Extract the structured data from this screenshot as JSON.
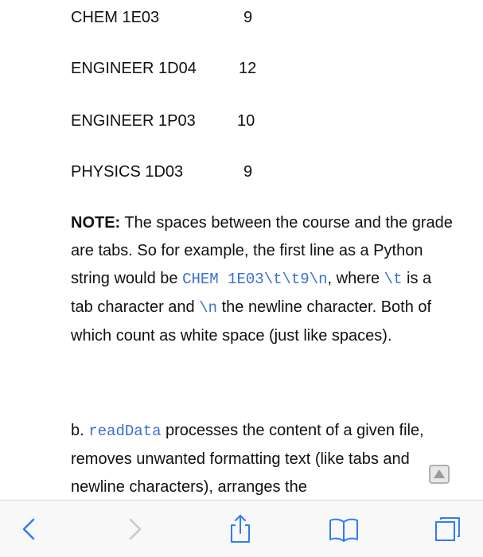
{
  "grades": [
    {
      "course": "CHEM 1E03",
      "grade": "9"
    },
    {
      "course": "ENGINEER 1D04",
      "grade": "12"
    },
    {
      "course": "ENGINEER 1P03",
      "grade": "10"
    },
    {
      "course": "PHYSICS 1D03",
      "grade": "9"
    }
  ],
  "note": {
    "label": "NOTE:",
    "text1": " The spaces between the course and the grade are tabs. So for example, the first line as a Python string would be ",
    "code1": "CHEM 1E03\\t\\t9\\n",
    "text2": ", where ",
    "code2": "\\t",
    "text3": " is a tab character and ",
    "code3": "\\n",
    "text4": " the newline character. Both of which count as white space (just like spaces)."
  },
  "part_b": {
    "prefix": "b. ",
    "code": "readData",
    "text": " processes the content of a given file, removes unwanted formatting text (like tabs and newline characters), arranges the"
  },
  "toolbar": {
    "icons": [
      "back-icon",
      "forward-icon",
      "share-icon",
      "bookmarks-icon",
      "tabs-icon"
    ],
    "accent": "#2f7cf6",
    "disabled": "#c7c7cc"
  }
}
